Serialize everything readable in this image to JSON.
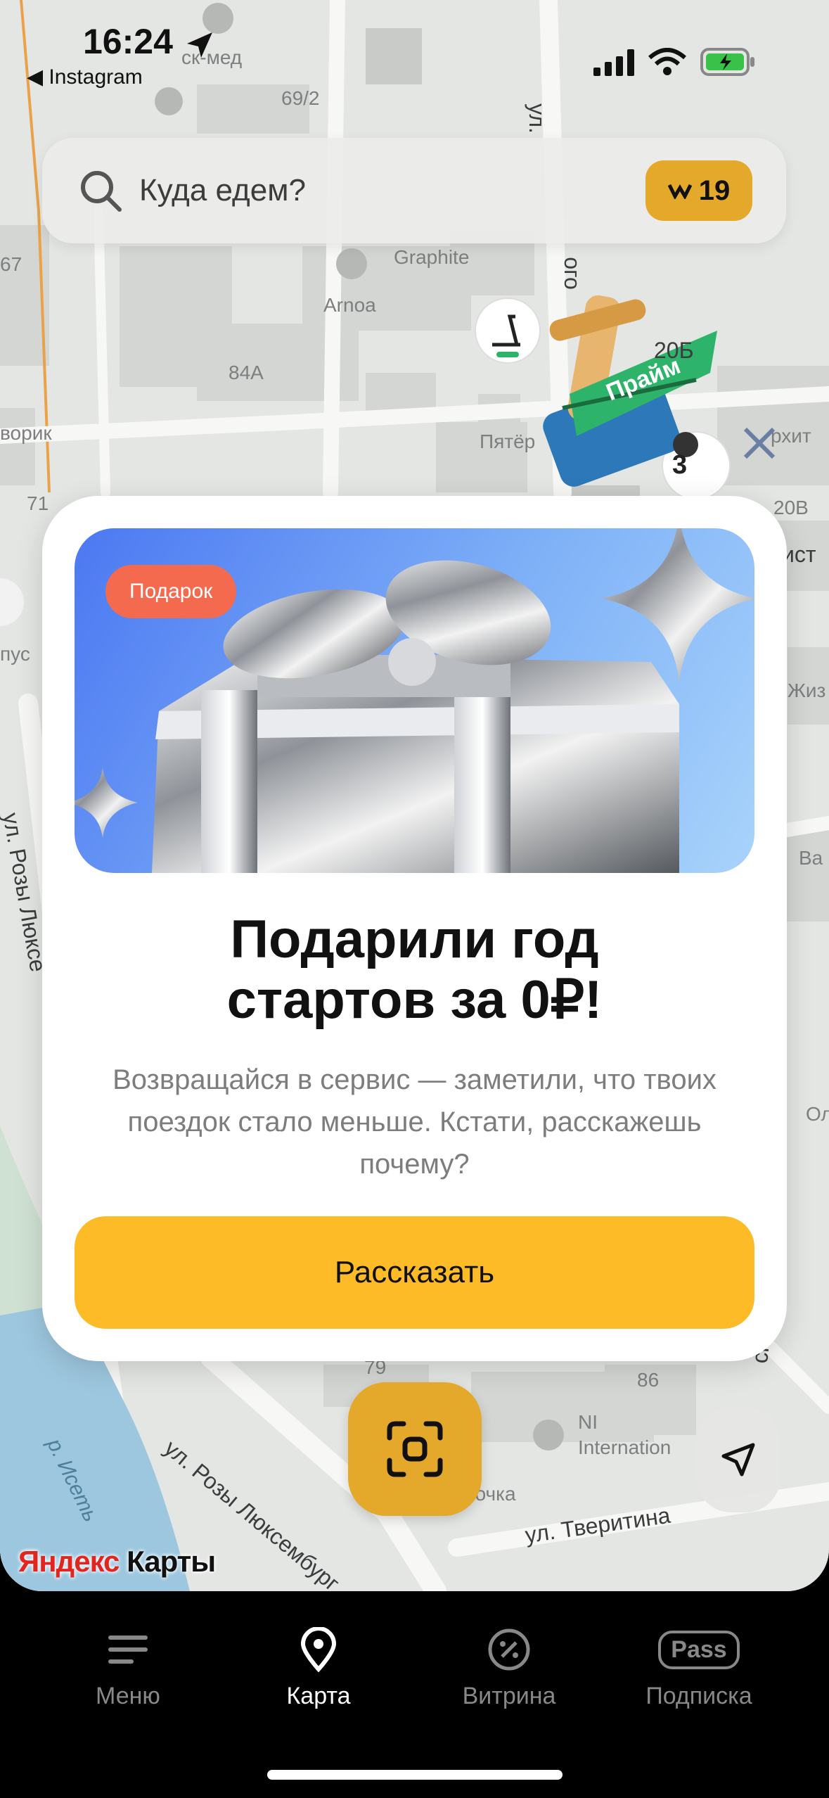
{
  "status_bar": {
    "time": "16:24",
    "back_app": "◀ Instagram"
  },
  "search": {
    "placeholder": "Куда едем?",
    "badge_count": "19"
  },
  "map": {
    "labels": {
      "med": "ск-мед",
      "b69_2": "69/2",
      "street_top": "ул.",
      "graphite": "Graphite",
      "arnoa": "Arnoa",
      "b84a": "84A",
      "b20b_small": "20Б",
      "vorik": "ворик",
      "pyater": "Пятёр",
      "arhit": "рхит",
      "b71": "71",
      "b20v": "20В",
      "b67": "67",
      "ist": "ист",
      "pus": "пус",
      "zhiz": "Жиз",
      "rozy_left": "ул. Розы Люксе",
      "va": "Ва",
      "ol": "Ол",
      "b79": "79",
      "b86": "86",
      "ni": "NI",
      "international": "Internation",
      "rozy_bottom": "ул. Розы Люксембург",
      "river": "р. Исеть",
      "ochka": "рочка",
      "tveritina": "ул. Тверитина",
      "skogo": "ского",
      "ogo": "ого",
      "scooter_count": "3"
    },
    "prime_ribbon": "Прайм"
  },
  "promo": {
    "pill": "Подарок",
    "title_line1": "Подарили год",
    "title_line2": "стартов за 0₽!",
    "subtitle": "Возвращайся в сервис — заметили, что твоих поездок стало меньше. Кстати, расскажешь почему?",
    "cta": "Рассказать"
  },
  "brand": {
    "first": "Яндекс",
    "second": " Карты"
  },
  "tabs": [
    {
      "label": "Меню",
      "icon": "menu-icon"
    },
    {
      "label": "Карта",
      "icon": "map-pin-icon"
    },
    {
      "label": "Витрина",
      "icon": "discount-icon"
    },
    {
      "label": "Подписка",
      "icon": "pass-icon",
      "badge_text": "Pass"
    }
  ],
  "colors": {
    "accent_yellow": "#fdbb28",
    "button_gold": "#e4a82a",
    "pill_red": "#f36a4e"
  }
}
